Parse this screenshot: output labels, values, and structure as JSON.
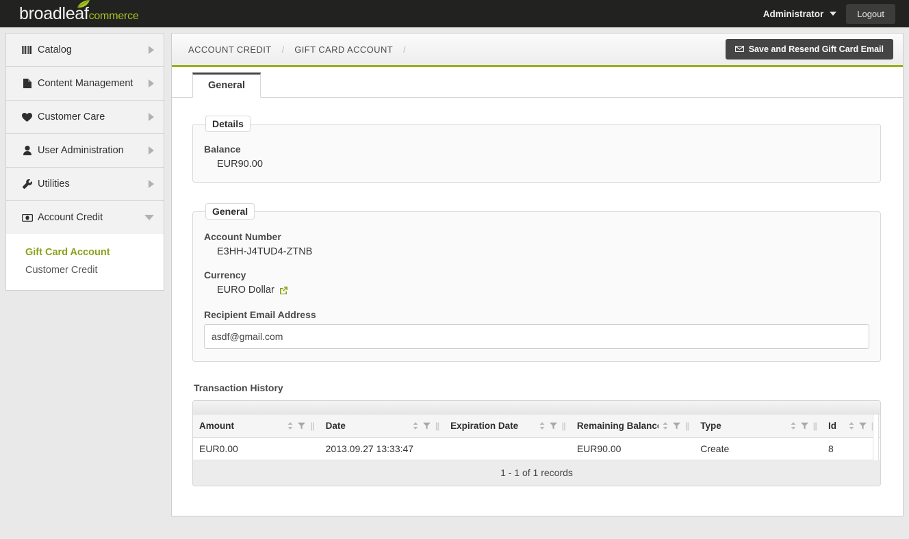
{
  "header": {
    "logo_text_1": "broadleaf",
    "logo_text_2": "commerce",
    "admin_label": "Administrator",
    "logout_label": "Logout",
    "brand_green": "#a5c520",
    "bar_color": "#222221"
  },
  "sidebar": {
    "items": [
      {
        "label": "Catalog",
        "icon": "barcode-icon",
        "expanded": false
      },
      {
        "label": "Content Management",
        "icon": "document-icon",
        "expanded": false
      },
      {
        "label": "Customer Care",
        "icon": "heart-icon",
        "expanded": false
      },
      {
        "label": "User Administration",
        "icon": "user-icon",
        "expanded": false
      },
      {
        "label": "Utilities",
        "icon": "wrench-icon",
        "expanded": false
      },
      {
        "label": "Account Credit",
        "icon": "money-icon",
        "expanded": true
      }
    ],
    "submenu": [
      {
        "label": "Gift Card Account",
        "active": true
      },
      {
        "label": "Customer Credit",
        "active": false
      }
    ],
    "active_color": "#8aa11a"
  },
  "breadcrumb": {
    "items": [
      "ACCOUNT CREDIT",
      "GIFT CARD ACCOUNT"
    ],
    "separator": "/",
    "accent_color": "#9bb11b"
  },
  "actions": {
    "save_resend_label": "Save and Resend Gift Card Email",
    "save_resend_icon": "envelope-icon"
  },
  "tabs": [
    {
      "label": "General",
      "active": true
    }
  ],
  "details": {
    "legend": "Details",
    "balance_label": "Balance",
    "balance_value": "EUR90.00"
  },
  "general": {
    "legend": "General",
    "account_number_label": "Account Number",
    "account_number_value": "E3HH-J4TUD4-ZTNB",
    "currency_label": "Currency",
    "currency_value": "EURO Dollar",
    "currency_link_icon": "external-link-icon",
    "email_label": "Recipient Email Address",
    "email_value": "asdf@gmail.com",
    "email_placeholder": ""
  },
  "transactions": {
    "title": "Transaction History",
    "columns": [
      {
        "label": "Amount",
        "sortable": true,
        "filterable": true
      },
      {
        "label": "Date",
        "sortable": true,
        "filterable": true
      },
      {
        "label": "Expiration Date",
        "sortable": true,
        "filterable": true
      },
      {
        "label": "Remaining Balance",
        "sortable": true,
        "filterable": true
      },
      {
        "label": "Type",
        "sortable": true,
        "filterable": true
      },
      {
        "label": "Id",
        "sortable": true,
        "filterable": true
      }
    ],
    "rows": [
      {
        "amount": "EUR0.00",
        "date": "2013.09.27 13:33:47",
        "expiration_date": "",
        "remaining_balance": "EUR90.00",
        "type": "Create",
        "id": "8"
      }
    ],
    "footer": "1 - 1 of 1 records"
  }
}
